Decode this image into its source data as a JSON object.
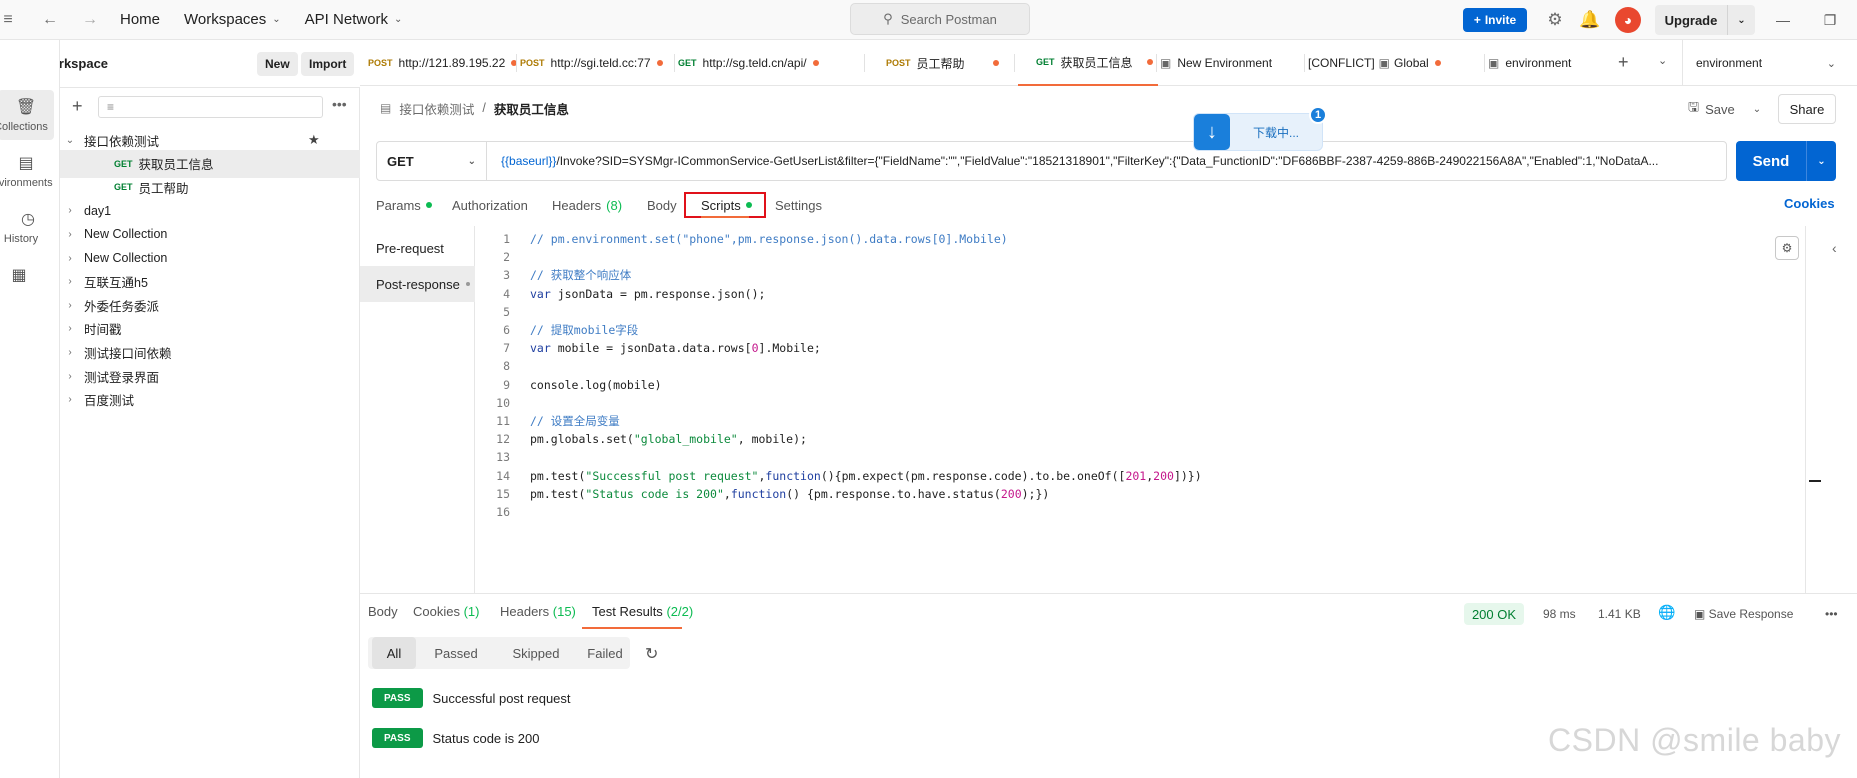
{
  "topbar": {
    "home": "Home",
    "workspaces": "Workspaces",
    "api_network": "API Network",
    "search_placeholder": "Search Postman",
    "invite": "Invite",
    "upgrade": "Upgrade"
  },
  "workspace": {
    "title": "My Workspace",
    "new_button": "New",
    "import_button": "Import"
  },
  "rail": {
    "items": [
      {
        "label": "Collections",
        "icon": "collections-icon",
        "active": true
      },
      {
        "label": "Environments",
        "icon": "environments-icon",
        "active": false
      },
      {
        "label": "History",
        "icon": "history-icon",
        "active": false
      },
      {
        "label": "",
        "icon": "apps-icon",
        "active": false
      }
    ]
  },
  "sidebar": {
    "tree": [
      {
        "label": "接口依赖测试",
        "level": 0,
        "expanded": true,
        "starred": true
      },
      {
        "label": "获取员工信息",
        "level": 1,
        "method": "GET",
        "selected": true
      },
      {
        "label": "员工帮助",
        "level": 1,
        "method": "GET"
      },
      {
        "label": "day1",
        "level": 0
      },
      {
        "label": "New Collection",
        "level": 0
      },
      {
        "label": "New Collection",
        "level": 0
      },
      {
        "label": "互联互通h5",
        "level": 0
      },
      {
        "label": "外委任务委派",
        "level": 0
      },
      {
        "label": "时间戳",
        "level": 0
      },
      {
        "label": "测试接口间依赖",
        "level": 0
      },
      {
        "label": "测试登录界面",
        "level": 0
      },
      {
        "label": "百度测试",
        "level": 0
      }
    ]
  },
  "tabs": [
    {
      "method": "POST",
      "label": "http://121.89.195.22",
      "dot": true
    },
    {
      "method": "POST",
      "label": "http://sgi.teld.cc:77",
      "dot": true
    },
    {
      "method": "GET",
      "label": "http://sg.teld.cn/api/",
      "dot": true
    },
    {
      "method": "POST",
      "label": "员工帮助",
      "dot": true
    },
    {
      "method": "GET",
      "label": "获取员工信息",
      "dot": true,
      "active": true
    },
    {
      "method": "",
      "label": "New Environment",
      "dot": false
    },
    {
      "method": "",
      "label": "[CONFLICT]",
      "label2": "Global",
      "dot": true
    },
    {
      "method": "",
      "label": "environment",
      "dot": false
    }
  ],
  "env_selector": "environment",
  "request": {
    "breadcrumb_parent": "接口依赖测试",
    "breadcrumb_sep": "/",
    "breadcrumb_current": "获取员工信息",
    "save": "Save",
    "share": "Share",
    "method": "GET",
    "url_var": "{{baseurl}}",
    "url_rest": "/Invoke?SID=SYSMgr-ICommonService-GetUserList&filter={\"FieldName\":\"\",\"FieldValue\":\"18521318901\",\"FilterKey\":{\"Data_FunctionID\":\"DF686BBF-2387-4259-886B-249022156A8A\",\"Enabled\":1,\"NoDataA...",
    "send": "Send"
  },
  "download": {
    "text": "下载中...",
    "badge": "1"
  },
  "req_tabs": [
    {
      "label": "Params",
      "dot": true
    },
    {
      "label": "Authorization"
    },
    {
      "label": "Headers",
      "count": "(8)"
    },
    {
      "label": "Body"
    },
    {
      "label": "Scripts",
      "dot": true,
      "active": true
    },
    {
      "label": "Settings"
    }
  ],
  "cookies_link": "Cookies",
  "script_side": {
    "pre": "Pre-request",
    "post": "Post-response"
  },
  "code": [
    [
      [
        "com",
        "// pm.environment.set(\"phone\",pm.response.json().data.rows[0].Mobile)"
      ]
    ],
    [],
    [
      [
        "com",
        "// 获取整个响应体"
      ]
    ],
    [
      [
        "kw",
        "var"
      ],
      [
        "plain",
        " jsonData = pm.response.json();"
      ]
    ],
    [],
    [
      [
        "com",
        "// 提取mobile字段"
      ]
    ],
    [
      [
        "kw",
        "var"
      ],
      [
        "plain",
        " mobile = jsonData.data.rows["
      ],
      [
        "num",
        "0"
      ],
      [
        "plain",
        "].Mobile;"
      ]
    ],
    [],
    [
      [
        "plain",
        "console.log(mobile)"
      ]
    ],
    [],
    [
      [
        "com",
        "// 设置全局变量"
      ]
    ],
    [
      [
        "plain",
        "pm.globals.set("
      ],
      [
        "str",
        "\"global_mobile\""
      ],
      [
        "plain",
        ", mobile);"
      ]
    ],
    [],
    [
      [
        "plain",
        "pm.test("
      ],
      [
        "str",
        "\"Successful post request\""
      ],
      [
        "plain",
        ","
      ],
      [
        "kw",
        "function"
      ],
      [
        "plain",
        "(){pm.expect(pm.response.code).to.be.oneOf(["
      ],
      [
        "num",
        "201"
      ],
      [
        "plain",
        ","
      ],
      [
        "num",
        "200"
      ],
      [
        "plain",
        "])})"
      ]
    ],
    [
      [
        "plain",
        "pm.test("
      ],
      [
        "str",
        "\"Status code is 200\""
      ],
      [
        "plain",
        ","
      ],
      [
        "kw",
        "function"
      ],
      [
        "plain",
        "() {pm.response.to.have.status("
      ],
      [
        "num",
        "200"
      ],
      [
        "plain",
        ");})"
      ]
    ],
    []
  ],
  "response": {
    "tabs": [
      {
        "label": "Body"
      },
      {
        "label": "Cookies",
        "count": "(1)"
      },
      {
        "label": "Headers",
        "count": "(15)"
      },
      {
        "label": "Test Results",
        "count": "(2/2)",
        "active": true
      }
    ],
    "status": "200 OK",
    "time": "98 ms",
    "size": "1.41 KB",
    "save_response": "Save Response",
    "filters": [
      "All",
      "Passed",
      "Skipped",
      "Failed"
    ],
    "results": [
      {
        "badge": "PASS",
        "label": "Successful post request"
      },
      {
        "badge": "PASS",
        "label": "Status code is 200"
      }
    ]
  },
  "watermark": "CSDN @smile baby",
  "colors": {
    "accent": "#f26b3a",
    "primary": "#0265d2",
    "success": "#0c9a47",
    "highlight_box": "#e0111a"
  }
}
